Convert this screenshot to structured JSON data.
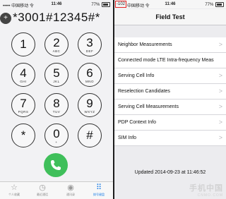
{
  "left": {
    "status": {
      "carrier": "••••• 中国移动 令",
      "time": "11:46",
      "battery": "77%"
    },
    "dial_input": "*3001#12345#*",
    "keys": [
      {
        "num": "1",
        "sub": ""
      },
      {
        "num": "2",
        "sub": "ABC"
      },
      {
        "num": "3",
        "sub": "DEF"
      },
      {
        "num": "4",
        "sub": "GHI"
      },
      {
        "num": "5",
        "sub": "JKL"
      },
      {
        "num": "6",
        "sub": "MNO"
      },
      {
        "num": "7",
        "sub": "PQRS"
      },
      {
        "num": "8",
        "sub": "TUV"
      },
      {
        "num": "9",
        "sub": "WXYZ"
      },
      {
        "num": "*",
        "sub": ""
      },
      {
        "num": "0",
        "sub": "+"
      },
      {
        "num": "#",
        "sub": ""
      }
    ],
    "tabs": [
      {
        "icon": "☆",
        "label": "个人收藏"
      },
      {
        "icon": "◷",
        "label": "最近通话"
      },
      {
        "icon": "◉",
        "label": "通讯录"
      },
      {
        "icon": "⠿",
        "label": "拨号键盘"
      }
    ]
  },
  "right": {
    "status": {
      "signal": "-102",
      "carrier": "中国移动 令",
      "time": "11:46",
      "battery": "77%"
    },
    "title": "Field Test",
    "rows": [
      "Neighbor Measurements",
      "Connected mode LTE Intra-frequency Meas",
      "Serving Cell Info",
      "Reselection Candidates",
      "Serving Cell Measurements",
      "PDP Context Info",
      "SIM Info"
    ],
    "chevron": ">",
    "footer": "Updated 2014-09-23 at 11:46:52"
  },
  "watermark": {
    "line1": "手机中国",
    "line2": "CNMO.COM"
  }
}
